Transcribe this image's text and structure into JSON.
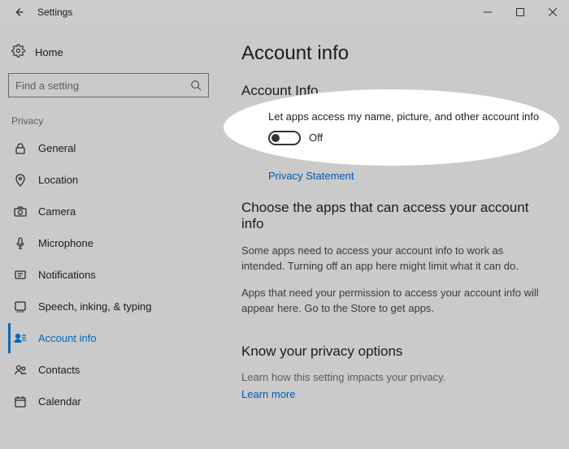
{
  "titlebar": {
    "app_name": "Settings"
  },
  "sidebar": {
    "home_label": "Home",
    "search_placeholder": "Find a setting",
    "category_label": "Privacy",
    "items": [
      {
        "label": "General"
      },
      {
        "label": "Location"
      },
      {
        "label": "Camera"
      },
      {
        "label": "Microphone"
      },
      {
        "label": "Notifications"
      },
      {
        "label": "Speech, inking, & typing"
      },
      {
        "label": "Account info"
      },
      {
        "label": "Contacts"
      },
      {
        "label": "Calendar"
      }
    ]
  },
  "main": {
    "page_title": "Account info",
    "section1": {
      "heading": "Account Info",
      "toggle_description": "Let apps access my name, picture, and other account info",
      "toggle_state_label": "Off",
      "privacy_link": "Privacy Statement"
    },
    "section2": {
      "heading": "Choose the apps that can access your account info",
      "para1": "Some apps need to access your account info to work as intended. Turning off an app here might limit what it can do.",
      "para2": "Apps that need your permission to access your account info will appear here. Go to the Store to get apps."
    },
    "section3": {
      "heading": "Know your privacy options",
      "para": "Learn how this setting impacts your privacy.",
      "link": "Learn more"
    }
  }
}
